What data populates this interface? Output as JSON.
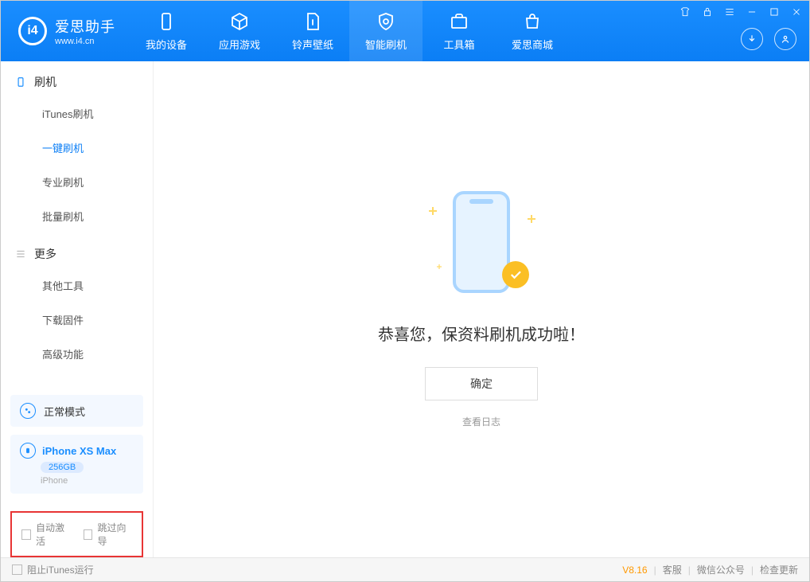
{
  "app": {
    "name_cn": "爱思助手",
    "name_en": "www.i4.cn"
  },
  "tabs": {
    "device": "我的设备",
    "apps": "应用游戏",
    "ringtone": "铃声壁纸",
    "flash": "智能刷机",
    "toolbox": "工具箱",
    "store": "爱思商城"
  },
  "sidebar": {
    "group_flash": "刷机",
    "items_flash": [
      "iTunes刷机",
      "一键刷机",
      "专业刷机",
      "批量刷机"
    ],
    "group_more": "更多",
    "items_more": [
      "其他工具",
      "下载固件",
      "高级功能"
    ]
  },
  "mode": {
    "label": "正常模式"
  },
  "device": {
    "name": "iPhone XS Max",
    "storage": "256GB",
    "type": "iPhone"
  },
  "options": {
    "auto_activate": "自动激活",
    "skip_guide": "跳过向导"
  },
  "main": {
    "success_text": "恭喜您，保资料刷机成功啦！",
    "ok_button": "确定",
    "view_log": "查看日志"
  },
  "footer": {
    "block_itunes": "阻止iTunes运行",
    "version": "V8.16",
    "support": "客服",
    "wechat": "微信公众号",
    "update": "检查更新"
  }
}
